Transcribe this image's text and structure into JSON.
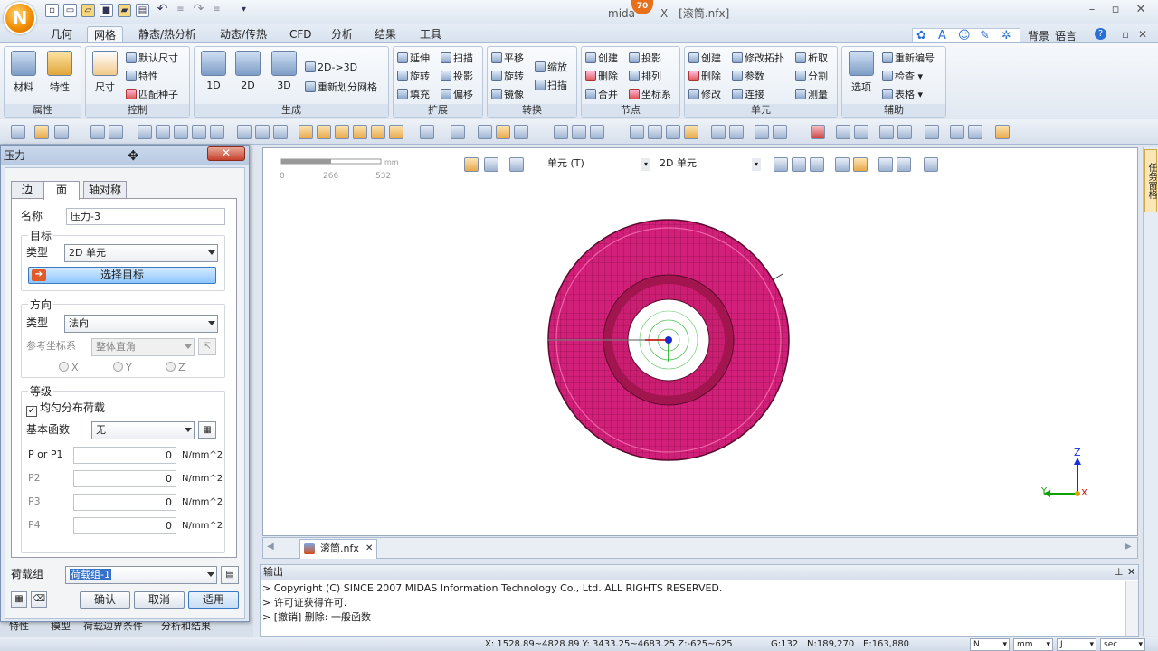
{
  "app": {
    "logo_letter": "N",
    "title_prefix": "mida",
    "title_suffix": "X - [滚筒.nfx]",
    "badge": "70",
    "quick_access": [
      "new",
      "open",
      "open-folder",
      "save",
      "save-as",
      "print",
      "undo",
      "redo-list",
      "redo",
      "redo-list",
      "customize"
    ]
  },
  "ribbon": {
    "tabs": [
      "几何",
      "网格",
      "静态/热分析",
      "动态/传热",
      "CFD",
      "分析",
      "结果",
      "工具"
    ],
    "active_tab": "网格",
    "groups": {
      "property": {
        "label": "属性",
        "buttons": [
          "材料",
          "特性"
        ]
      },
      "control": {
        "label": "控制",
        "big": "尺寸",
        "small": [
          "默认尺寸",
          "特性",
          "匹配种子"
        ]
      },
      "generate": {
        "label": "生成",
        "big": [
          "1D",
          "2D",
          "3D"
        ],
        "small": [
          "2D->3D",
          "重新划分网格"
        ]
      },
      "extend": {
        "label": "扩展",
        "small": [
          "延伸",
          "扫描",
          "旋转",
          "投影",
          "填充",
          "偏移"
        ]
      },
      "transform": {
        "label": "转换",
        "small": [
          "平移",
          "缩放",
          "旋转",
          "扫描",
          "镜像"
        ]
      },
      "node": {
        "label": "节点",
        "small": [
          "创建",
          "投影",
          "删除",
          "排列",
          "合并",
          "坐标系"
        ]
      },
      "element": {
        "label": "单元",
        "small": [
          "创建",
          "修改拓扑",
          "析取",
          "删除",
          "参数",
          "分割",
          "修改",
          "连接",
          "测量"
        ]
      },
      "aux": {
        "label": "辅助",
        "big": "选项",
        "small": [
          "重新编号",
          "检查",
          "表格"
        ]
      }
    },
    "right_items": [
      "背景",
      "语言"
    ]
  },
  "viewport": {
    "scale_labels": [
      "0",
      "266",
      "532"
    ],
    "scale_unit": "mm",
    "filter_mode": "单元 (T)",
    "filter_type": "2D 单元",
    "axis_z": "Z",
    "axis_y": "Y",
    "axis_x": "X"
  },
  "file_tab": {
    "name": "滚筒.nfx"
  },
  "output": {
    "title": "输出",
    "lines": [
      "> Copyright (C) SINCE 2007 MIDAS Information Technology Co., Ltd. ALL RIGHTS RESERVED.",
      "> 许可证获得许可.",
      "> [撤销] 删除: 一般函数"
    ]
  },
  "status": {
    "coords": "X: 1528.89~4828.89 Y: 3433.25~4683.25 Z:-625~625",
    "group": "G:132",
    "nodes": "N:189,270",
    "elements": "E:163,880",
    "unit_force": "N",
    "unit_length": "mm",
    "unit_energy": "J",
    "unit_time": "sec"
  },
  "right_rail": {
    "label": "任务窗格"
  },
  "bottom_tabs": [
    "特性",
    "模型",
    "荷载边界条件",
    "分析和结果"
  ],
  "dialog": {
    "title": "压力",
    "tabs": [
      "边",
      "面",
      "轴对称"
    ],
    "active_tab": "面",
    "name_label": "名称",
    "name_value": "压力-3",
    "target": {
      "legend": "目标",
      "type_label": "类型",
      "type_value": "2D 单元",
      "select_button": "选择目标"
    },
    "direction": {
      "legend": "方向",
      "type_label": "类型",
      "type_value": "法向",
      "cs_label": "参考坐标系",
      "cs_value": "整体直角",
      "axes": [
        "X",
        "Y",
        "Z"
      ]
    },
    "level": {
      "legend": "等级",
      "uniform_label": "均匀分布荷载",
      "uniform_checked": true,
      "basis_label": "基本函数",
      "basis_value": "无",
      "rows": [
        {
          "label": "P or P1",
          "value": "0",
          "unit": "N/mm^2"
        },
        {
          "label": "P2",
          "value": "0",
          "unit": "N/mm^2"
        },
        {
          "label": "P3",
          "value": "0",
          "unit": "N/mm^2"
        },
        {
          "label": "P4",
          "value": "0",
          "unit": "N/mm^2"
        }
      ]
    },
    "load_group_label": "荷载组",
    "load_group_value": "荷载组-1",
    "buttons": {
      "ok": "确认",
      "cancel": "取消",
      "apply": "适用"
    }
  }
}
